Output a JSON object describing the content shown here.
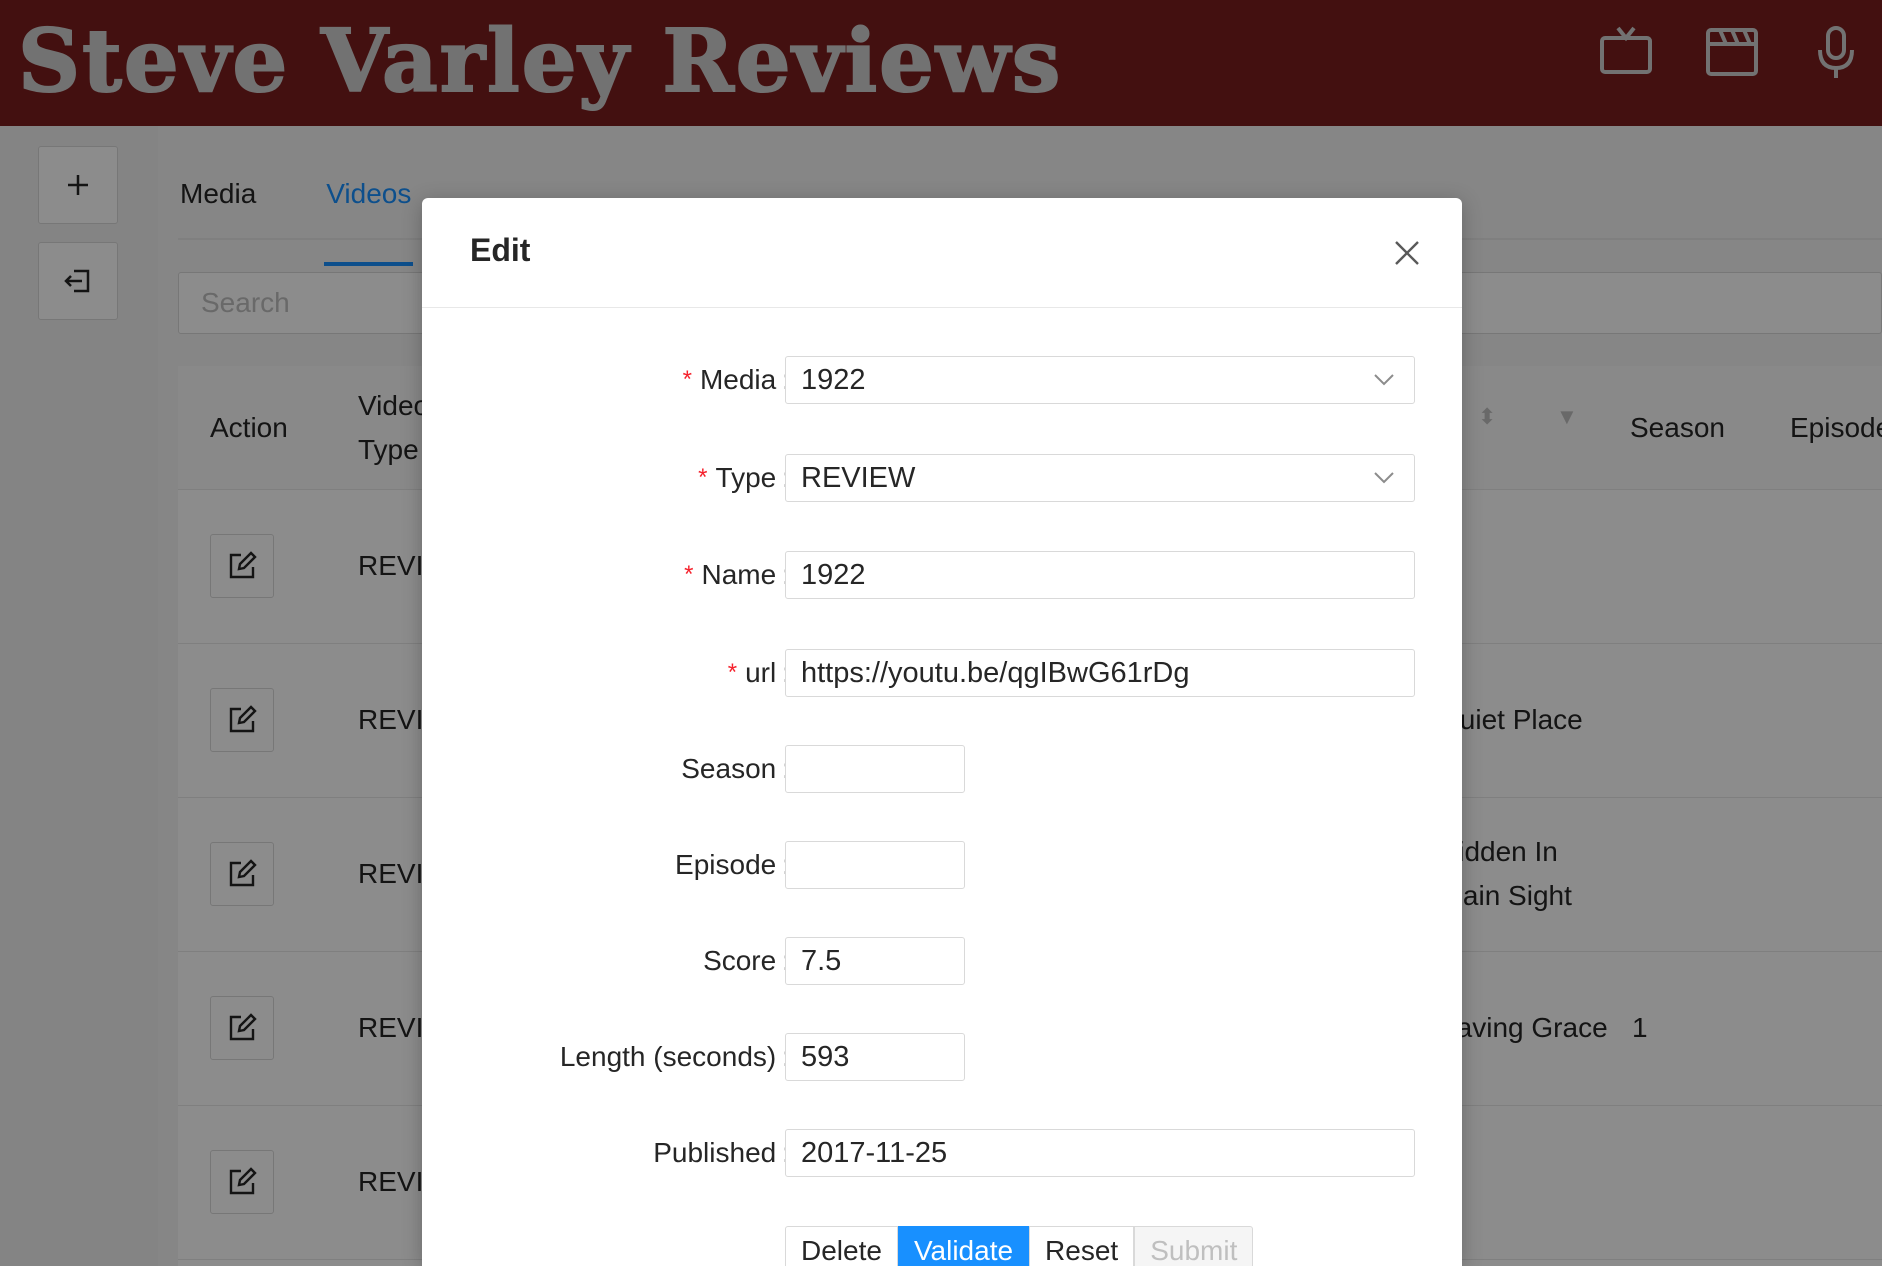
{
  "header": {
    "brand": "Steve Varley Reviews",
    "icons": [
      "tv-icon",
      "clapperboard-icon",
      "microphone-icon"
    ]
  },
  "rail": {
    "icons": [
      "plus-icon",
      "logout-icon"
    ]
  },
  "tabs": [
    {
      "label": "Media",
      "active": false
    },
    {
      "label": "Videos",
      "active": true
    }
  ],
  "search": {
    "placeholder": "Search"
  },
  "table": {
    "headers": {
      "action": "Action",
      "video_type_line1": "Video",
      "video_type_line2": "Type",
      "season": "Season",
      "episode": "Episode"
    },
    "rows": [
      {
        "type": "REVIEW",
        "name": "",
        "name2": "",
        "season": ""
      },
      {
        "type": "REVIEW",
        "name": "Quiet Place",
        "name2": "",
        "season": ""
      },
      {
        "type": "REVIEW",
        "name": "Hidden In",
        "name2": "Plain Sight",
        "season": ""
      },
      {
        "type": "REVIEW",
        "name": "Saving Grace",
        "name2": "",
        "season": "1"
      },
      {
        "type": "REVIEW",
        "name": "",
        "name2": "",
        "season": ""
      }
    ]
  },
  "modal": {
    "title": "Edit",
    "fields": {
      "media": {
        "label": "Media",
        "value": "1922",
        "required": true
      },
      "type": {
        "label": "Type",
        "value": "REVIEW",
        "required": true
      },
      "name": {
        "label": "Name",
        "value": "1922",
        "required": true
      },
      "url": {
        "label": "url",
        "value": "https://youtu.be/qgIBwG61rDg",
        "required": true
      },
      "season": {
        "label": "Season",
        "value": ""
      },
      "episode": {
        "label": "Episode",
        "value": ""
      },
      "score": {
        "label": "Score",
        "value": "7.5"
      },
      "length": {
        "label": "Length (seconds)",
        "value": "593"
      },
      "published": {
        "label": "Published",
        "value": "2017-11-25"
      }
    },
    "buttons": {
      "delete": "Delete",
      "validate": "Validate",
      "reset": "Reset",
      "submit": "Submit"
    }
  },
  "colors": {
    "header_bg": "#7b1e1e",
    "brand_text": "#cfcfcf",
    "accent": "#1890ff",
    "required": "#f5222d"
  }
}
